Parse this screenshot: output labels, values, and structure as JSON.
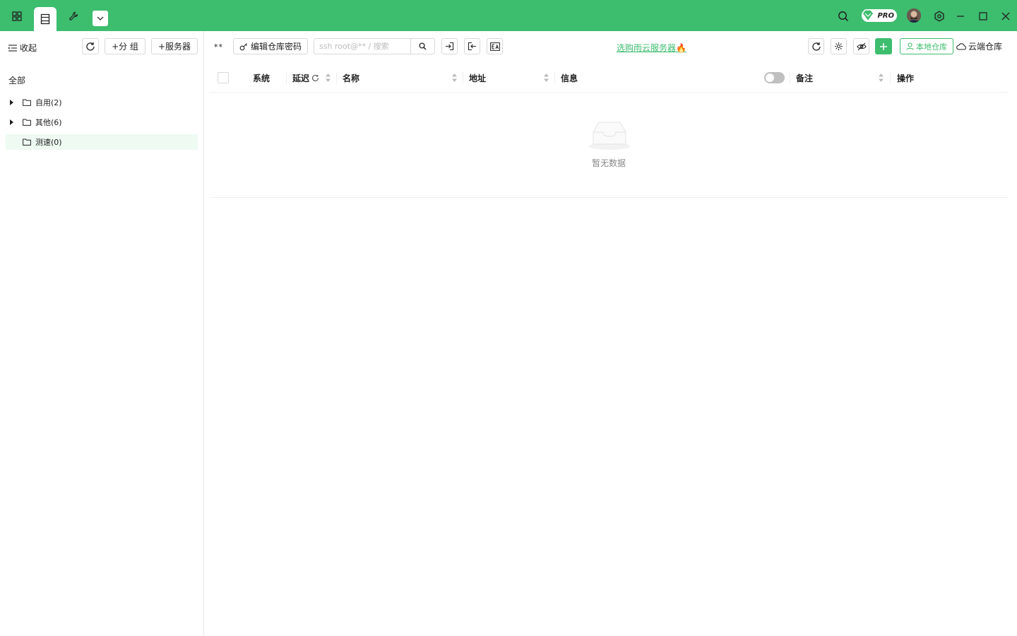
{
  "titlebar": {
    "icons": [
      "grid-icon",
      "server-list-icon",
      "wrench-icon",
      "chevron-down-icon"
    ],
    "right_icons": [
      "search-icon",
      "pro-badge",
      "avatar",
      "settings-icon",
      "minimize-icon",
      "maximize-icon",
      "close-icon"
    ],
    "pro_label": "PRO",
    "accent": "#3dbd6e"
  },
  "sidebar": {
    "collapse_label": "收起",
    "add_group_label": "+分 组",
    "add_server_label": "+服务器",
    "all_label": "全部",
    "groups": [
      {
        "label": "自用(2)",
        "expandable": true
      },
      {
        "label": "其他(6)",
        "expandable": true
      },
      {
        "label": "测速(0)",
        "expandable": false,
        "selected": true
      }
    ]
  },
  "toolbar": {
    "stars": "**",
    "edit_password_label": "编辑仓库密码",
    "search_placeholder": "ssh root@** / 搜索",
    "promo_link": "选购雨云服务器🔥",
    "local_repo_label": "本地仓库",
    "cloud_repo_label": "云端仓库"
  },
  "table": {
    "columns": {
      "system": "系统",
      "latency": "延迟",
      "name": "名称",
      "address": "地址",
      "info": "信息",
      "remark": "备注",
      "actions": "操作"
    },
    "empty_text": "暂无数据"
  }
}
